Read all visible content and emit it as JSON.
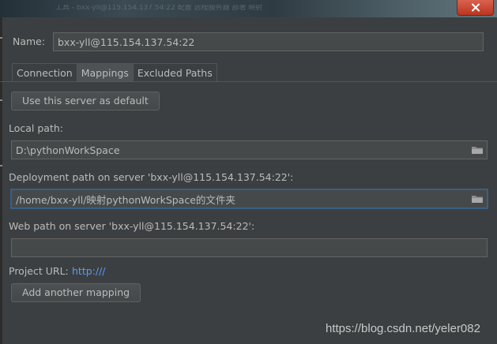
{
  "titlebar": {
    "blurred_text": "工具 - bxx-yll@115.154.137.54:22 配置 远程服务器 部署 映射"
  },
  "form": {
    "name_label": "Name:",
    "name_value": "bxx-yll@115.154.137.54:22"
  },
  "tabs": [
    {
      "label": "Connection",
      "selected": false
    },
    {
      "label": "Mappings",
      "selected": true
    },
    {
      "label": "Excluded Paths",
      "selected": false
    }
  ],
  "mappings": {
    "default_button": "Use this server as default",
    "local_path_label": "Local path:",
    "local_path_value": "D:\\pythonWorkSpace",
    "deployment_path_label": "Deployment path on server 'bxx-yll@115.154.137.54:22':",
    "deployment_path_value": "/home/bxx-yll/映射pythonWorkSpace的文件夹",
    "web_path_label": "Web path on server 'bxx-yll@115.154.137.54:22':",
    "web_path_value": "",
    "project_url_label": "Project URL:",
    "project_url_value": "http:///",
    "add_mapping_button": "Add another mapping"
  },
  "watermark": "https://blog.csdn.net/yeler082",
  "icons": [
    "close-icon",
    "folder-icon"
  ],
  "colors": {
    "background": "#3c3f41",
    "field": "#45494a",
    "link": "#589df6",
    "close": "#c7412b",
    "focus": "#3d6185"
  }
}
